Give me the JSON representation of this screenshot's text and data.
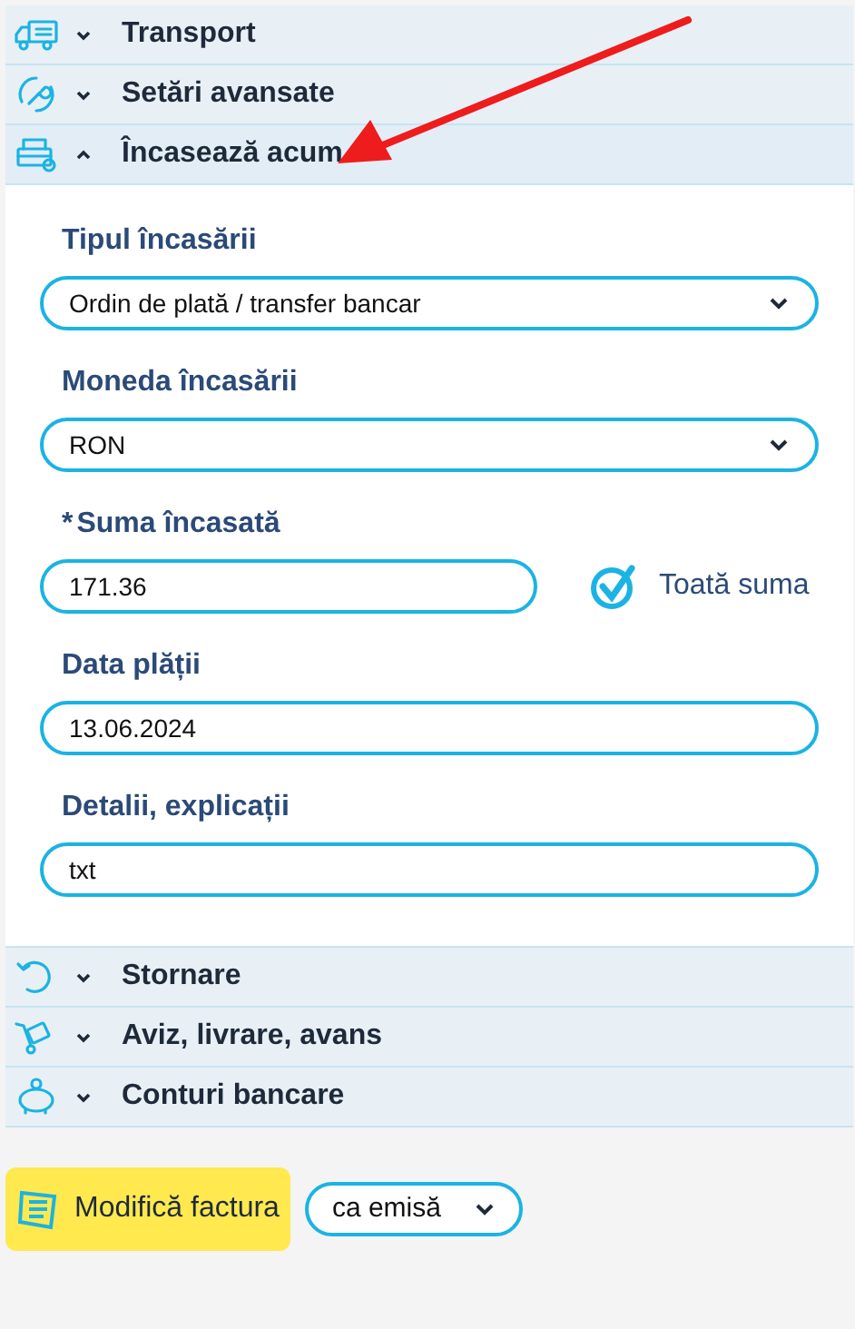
{
  "sections_top": [
    {
      "title": "Transport",
      "expanded": false
    },
    {
      "title": "Setări avansate",
      "expanded": false
    },
    {
      "title": "Încasează acum",
      "expanded": true
    }
  ],
  "form": {
    "fields": [
      {
        "kind": "select",
        "label": "Tipul încasării",
        "value": "Ordin de plată / transfer bancar"
      },
      {
        "kind": "select",
        "label": "Moneda încasării",
        "value": "RON"
      },
      {
        "kind": "input",
        "label": "Suma încasată",
        "required_mark": "*",
        "value": "171.36",
        "checkbox": {
          "label": "Toată suma",
          "checked": true
        }
      },
      {
        "kind": "input",
        "label": "Data plății",
        "value": "13.06.2024"
      },
      {
        "kind": "input",
        "label": "Detalii, explicații",
        "value": "txt"
      }
    ]
  },
  "sections_bottom": [
    {
      "title": "Stornare",
      "expanded": false
    },
    {
      "title": "Aviz, livrare, avans",
      "expanded": false
    },
    {
      "title": "Conturi bancare",
      "expanded": false
    }
  ],
  "footer": {
    "button": "Modifică factura",
    "mode_select": "ca emisă"
  }
}
